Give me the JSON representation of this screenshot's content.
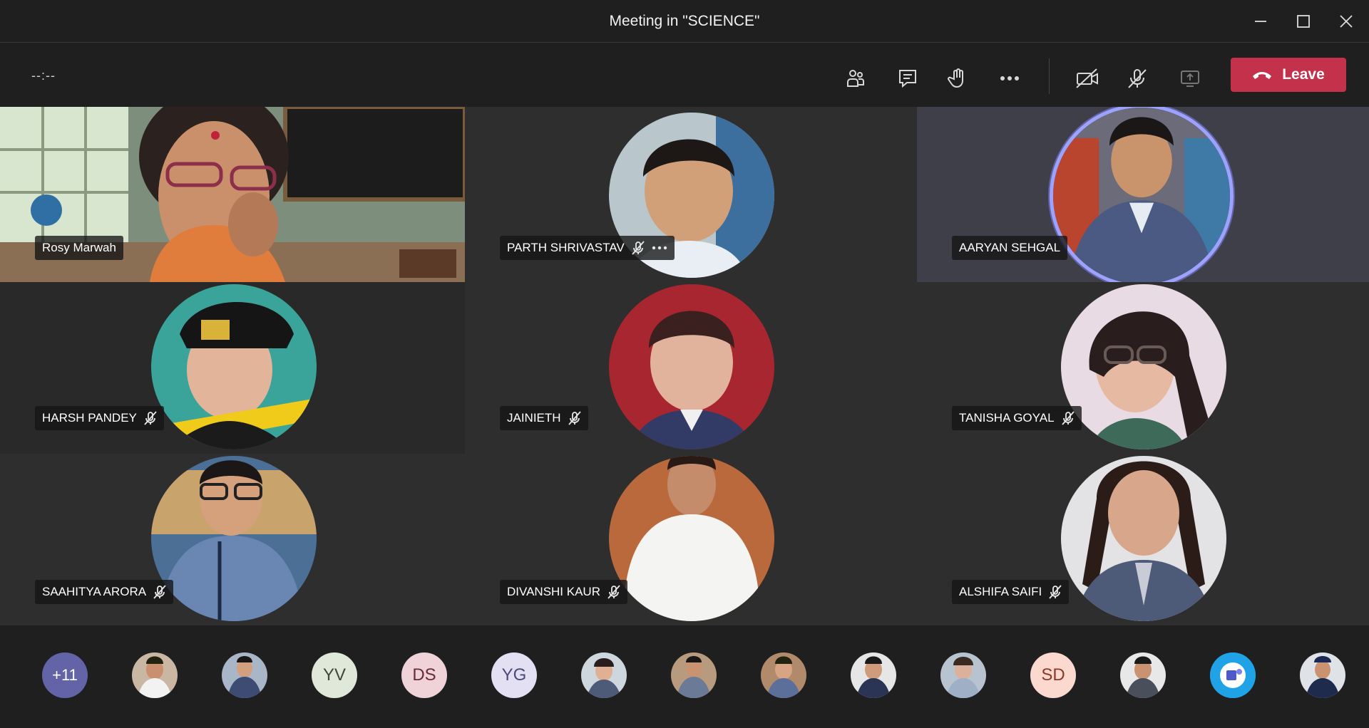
{
  "window": {
    "title": "Meeting in \"SCIENCE\""
  },
  "toolbar": {
    "timer": "--:--",
    "leave_label": "Leave"
  },
  "participants": [
    {
      "name": "Rosy Marwah"
    },
    {
      "name": "PARTH SHRIVASTAV"
    },
    {
      "name": "AARYAN SEHGAL"
    },
    {
      "name": "HARSH PANDEY"
    },
    {
      "name": "JAINIETH"
    },
    {
      "name": "TANISHA GOYAL"
    },
    {
      "name": "SAAHITYA ARORA"
    },
    {
      "name": "DIVANSHI KAUR"
    },
    {
      "name": "ALSHIFA SAIFI"
    }
  ],
  "strip": {
    "more_label": "+11",
    "initials": [
      "YV",
      "DS",
      "YG",
      "SD"
    ]
  },
  "colors": {
    "accent": "#6264a7",
    "leave": "#c4314b",
    "speaking_ring": "#9ea2ff"
  }
}
